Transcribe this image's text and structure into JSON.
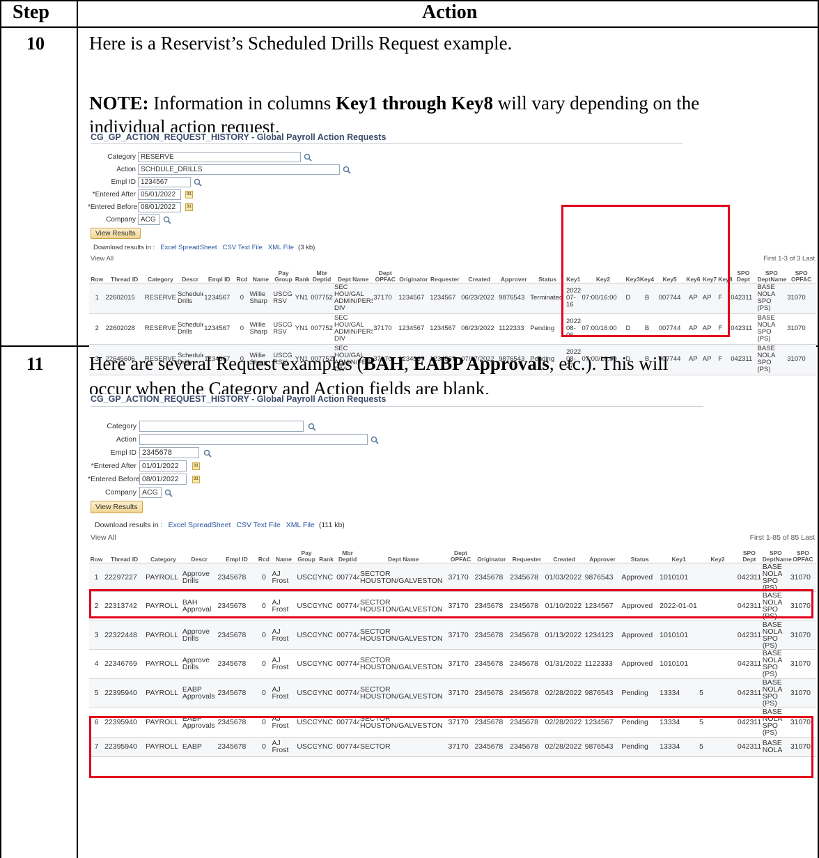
{
  "header": {
    "step": "Step",
    "action": "Action"
  },
  "step10": {
    "number": "10",
    "line1": "Here is a Reservist’s Scheduled Drills Request example.",
    "note_label": "NOTE:",
    "note_text_a": " Information in columns ",
    "note_bold": "Key1 through Key8",
    "note_text_b": " will vary depending on the",
    "note_line2": "individual action request.",
    "shot": {
      "title": "CG_GP_ACTION_REQUEST_HISTORY - Global Payroll Action Requests",
      "fields": {
        "category_label": "Category",
        "category_value": "RESERVE",
        "action_label": "Action",
        "action_value": "SCHDULE_DRILLS",
        "emplid_label": "Empl ID",
        "emplid_value": "1234567",
        "after_label": "*Entered After",
        "after_value": "05/01/2022",
        "before_label": "*Entered Before",
        "before_value": "08/01/2022",
        "company_label": "Company",
        "company_value": "ACG"
      },
      "view_results": "View Results",
      "download_label": "Download results in :",
      "dl_excel": "Excel SpreadSheet",
      "dl_csv": "CSV Text File",
      "dl_xml": "XML File",
      "dl_size": "(3 kb)",
      "view_all": "View All",
      "pager": "First  1-3 of 3  Last",
      "columns": [
        "Row",
        "Thread ID",
        "Category",
        "Descr",
        "Empl ID",
        "Rcd",
        "Name",
        "Pay Group",
        "Rank",
        "Mbr Deptid",
        "Dept Name",
        "Dept OPFAC",
        "Originator",
        "Requester",
        "Created",
        "Approver",
        "Status",
        "Key1",
        "Key2",
        "Key3",
        "Key4",
        "Key5",
        "Key6",
        "Key7",
        "Key8",
        "SPO Dept",
        "SPO DeptName",
        "SPO OPFAC"
      ],
      "rows": [
        [
          "1",
          "22602015",
          "RESERVE",
          "Schedule Drills",
          "1234567",
          "0",
          "Willie Sharp",
          "USCG RSV",
          "YN1",
          "007752",
          "SEC HOU/GAL ADMIN/PERS DIV",
          "37170",
          "1234567",
          "1234567",
          "06/23/2022",
          "9876543",
          "Terminated",
          "2022-07-16",
          "07:00/16:00",
          "D",
          "B",
          "007744",
          "AP",
          "AP",
          "F",
          "042311",
          "BASE NOLA SPO (PS)",
          "31070"
        ],
        [
          "2",
          "22602028",
          "RESERVE",
          "Schedule Drills",
          "1234567",
          "0",
          "Willie Sharp",
          "USCG RSV",
          "YN1",
          "007752",
          "SEC HOU/GAL ADMIN/PERS DIV",
          "37170",
          "1234567",
          "1234567",
          "06/23/2022",
          "1122333",
          "Pending",
          "2022-08-06",
          "07:00/16:00",
          "D",
          "B",
          "007744",
          "AP",
          "AP",
          "F",
          "042311",
          "BASE NOLA SPO (PS)",
          "31070"
        ],
        [
          "3",
          "22645606",
          "RESERVE",
          "Schedule Drills",
          "1234567",
          "0",
          "Willie Sharp",
          "USCG RSV",
          "YN1",
          "007752",
          "SEC HOU/GAL ADMIN/PERS DIV",
          "37170",
          "1234567",
          "1234567",
          "07/17/2022",
          "9876543",
          "Pending",
          "2022-08-27",
          "07:00/16:00",
          "D",
          "B",
          "007744",
          "AP",
          "AP",
          "F",
          "042311",
          "BASE NOLA SPO (PS)",
          "31070"
        ]
      ]
    }
  },
  "step11": {
    "number": "11",
    "line1_a": "Here are several Request examples (",
    "line1_b1": "BAH",
    "line1_c": ", ",
    "line1_b2": "EABP Approvals",
    "line1_d": ", etc.). This will",
    "line2": "occur when the Category and Action fields are blank.",
    "shot": {
      "title": "CG_GP_ACTION_REQUEST_HISTORY - Global Payroll Action Requests",
      "fields": {
        "category_label": "Category",
        "category_value": "",
        "action_label": "Action",
        "action_value": "",
        "emplid_label": "Empl ID",
        "emplid_value": "2345678",
        "after_label": "*Entered After",
        "after_value": "01/01/2022",
        "before_label": "*Entered Before",
        "before_value": "08/01/2022",
        "company_label": "Company",
        "company_value": "ACG"
      },
      "view_results": "View Results",
      "download_label": "Download results in :",
      "dl_excel": "Excel SpreadSheet",
      "dl_csv": "CSV Text File",
      "dl_xml": "XML File",
      "dl_size": "(111 kb)",
      "view_all": "View All",
      "pager": "First  1-85 of 85  Last",
      "columns": [
        "Row",
        "Thread ID",
        "Category",
        "Descr",
        "Empl ID",
        "Rcd",
        "Name",
        "Pay Group",
        "Rank",
        "Mbr Deptid",
        "Dept Name",
        "Dept OPFAC",
        "Originator",
        "Requester",
        "Created",
        "Approver",
        "Status",
        "Key1",
        "Key2",
        "SPO Dept",
        "SPO DeptName",
        "SPO OPFAC"
      ],
      "rows": [
        [
          "1",
          "22297227",
          "PAYROLL",
          "Approve Drills",
          "2345678",
          "0",
          "AJ Frost",
          "USCG",
          "YNC",
          "007744",
          "SECTOR HOUSTON/GALVESTON",
          "37170",
          "2345678",
          "2345678",
          "01/03/2022",
          "9876543",
          "Approved",
          "1010101",
          "",
          "042311",
          "BASE NOLA SPO (PS)",
          "31070"
        ],
        [
          "2",
          "22313742",
          "PAYROLL",
          "BAH Approval",
          "2345678",
          "0",
          "AJ Frost",
          "USCG",
          "YNC",
          "007744",
          "SECTOR HOUSTON/GALVESTON",
          "37170",
          "2345678",
          "2345678",
          "01/10/2022",
          "1234567",
          "Approved",
          "2022-01-01",
          "",
          "042311",
          "BASE NOLA SPO (PS)",
          "31070"
        ],
        [
          "3",
          "22322448",
          "PAYROLL",
          "Approve Drills",
          "2345678",
          "0",
          "AJ Frost",
          "USCG",
          "YNC",
          "007744",
          "SECTOR HOUSTON/GALVESTON",
          "37170",
          "2345678",
          "2345678",
          "01/13/2022",
          "1234123",
          "Approved",
          "1010101",
          "",
          "042311",
          "BASE NOLA SPO (PS)",
          "31070"
        ],
        [
          "4",
          "22346769",
          "PAYROLL",
          "Approve Drills",
          "2345678",
          "0",
          "AJ Frost",
          "USCG",
          "YNC",
          "007744",
          "SECTOR HOUSTON/GALVESTON",
          "37170",
          "2345678",
          "2345678",
          "01/31/2022",
          "1122333",
          "Approved",
          "1010101",
          "",
          "042311",
          "BASE NOLA SPO (PS)",
          "31070"
        ],
        [
          "5",
          "22395940",
          "PAYROLL",
          "EABP Approvals",
          "2345678",
          "0",
          "AJ Frost",
          "USCG",
          "YNC",
          "007744",
          "SECTOR HOUSTON/GALVESTON",
          "37170",
          "2345678",
          "2345678",
          "02/28/2022",
          "9876543",
          "Pending",
          "13334",
          "5",
          "042311",
          "BASE NOLA SPO (PS)",
          "31070"
        ],
        [
          "6",
          "22395940",
          "PAYROLL",
          "EABP Approvals",
          "2345678",
          "0",
          "AJ Frost",
          "USCG",
          "YNC",
          "007744",
          "SECTOR HOUSTON/GALVESTON",
          "37170",
          "2345678",
          "2345678",
          "02/28/2022",
          "1234567",
          "Pending",
          "13334",
          "5",
          "042311",
          "BASE NOLA SPO (PS)",
          "31070"
        ],
        [
          "7",
          "22395940",
          "PAYROLL",
          "EABP",
          "2345678",
          "0",
          "AJ Frost",
          "USCG",
          "YNC",
          "007744",
          "SECTOR",
          "37170",
          "2345678",
          "2345678",
          "02/28/2022",
          "9876543",
          "Pending",
          "13334",
          "5",
          "042311",
          "BASE NOLA",
          "31070"
        ]
      ]
    }
  }
}
